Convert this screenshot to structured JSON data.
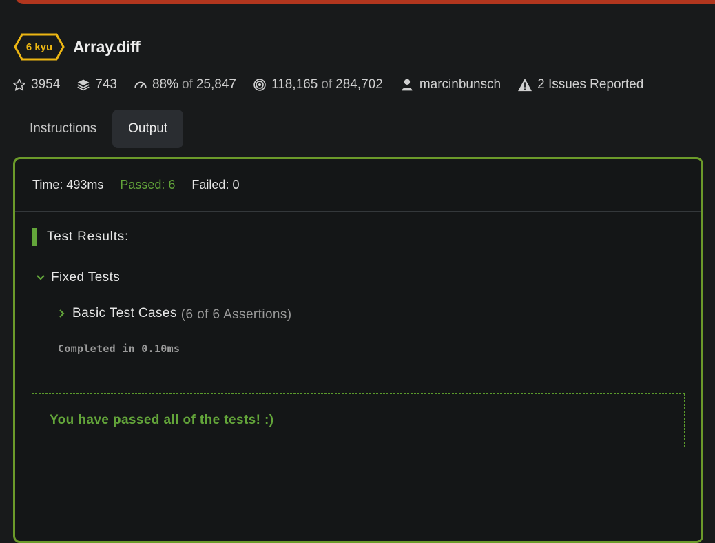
{
  "kata": {
    "rank": "6 kyu",
    "title": "Array.diff",
    "rank_color": "#ecb613"
  },
  "stats": {
    "stars": "3954",
    "collections": "743",
    "satisfaction": "88%",
    "satisfaction_of": "of",
    "satisfaction_votes": "25,847",
    "completed": "118,165",
    "completed_of": "of",
    "attempts": "284,702",
    "author": "marcinbunsch",
    "issues": "2 Issues Reported"
  },
  "tabs": [
    {
      "label": "Instructions",
      "active": false
    },
    {
      "label": "Output",
      "active": true
    }
  ],
  "output": {
    "time": "Time: 493ms",
    "passed": "Passed: 6",
    "failed": "Failed: 0",
    "results_heading": "Test Results:",
    "group": "Fixed Tests",
    "case_name": "Basic Test Cases",
    "case_assertions": "(6 of 6 Assertions)",
    "completed_in": "Completed in 0.10ms",
    "success_message": "You have passed all of the tests! :)"
  },
  "colors": {
    "accent_green": "#63a53a",
    "panel_border": "#6b9a2a",
    "top_bar": "#b1361e"
  },
  "icons": {
    "stars": "star-icon",
    "collections": "layers-icon",
    "satisfaction": "gauge-icon",
    "completed": "target-icon",
    "author": "user-icon",
    "issues": "warning-icon",
    "group_toggle": "chevron-down-icon",
    "case_toggle": "chevron-right-icon"
  }
}
